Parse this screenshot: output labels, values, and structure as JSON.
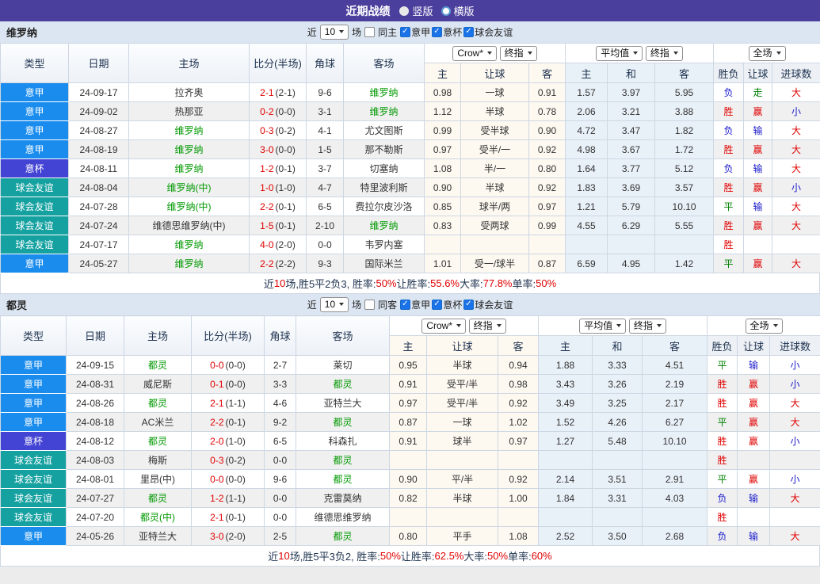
{
  "title_bar": {
    "title": "近期战绩",
    "layout_options": [
      {
        "label": "竖版",
        "selected": true
      },
      {
        "label": "横版",
        "selected": false
      }
    ]
  },
  "colors": {
    "accent_purple": "#4b3f9d",
    "filter_bar_bg": "#dce6f2",
    "league": {
      "意甲": "#1a8cee",
      "意杯": "#4444d4",
      "球会友谊": "#16a1a1"
    },
    "result": {
      "胜": "#e00000",
      "负": "#1a1acc",
      "平": "#008000",
      "赢": "#e00000",
      "输": "#1a1acc",
      "走": "#008000",
      "大": "#e00000",
      "小": "#1a1acc"
    },
    "score_red": "#e00000",
    "team_green": "#009900",
    "summary_red": "#e00000"
  },
  "sections": [
    {
      "team": "维罗纳",
      "filter": {
        "near": "近",
        "count": "10",
        "games": "场",
        "same": "同主",
        "same_checked": false,
        "leagues": [
          {
            "label": "意甲",
            "checked": true
          },
          {
            "label": "意杯",
            "checked": true
          },
          {
            "label": "球会友谊",
            "checked": true
          }
        ]
      },
      "header": {
        "cols": [
          "类型",
          "日期",
          "主场",
          "比分(半场)",
          "角球",
          "客场"
        ],
        "selects": {
          "book": "Crow*",
          "book_end": "终指",
          "avg": "平均值",
          "avg_end": "终指",
          "scope": "全场"
        },
        "handicap": [
          "主",
          "让球",
          "客"
        ],
        "avg": [
          "主",
          "和",
          "客"
        ],
        "result": [
          "胜负",
          "让球",
          "进球数"
        ]
      },
      "rows": [
        {
          "type": "意甲",
          "date": "24-09-17",
          "home": "拉齐奥",
          "home_green": false,
          "score": "2-1",
          "half": "(2-1)",
          "corner": "9-6",
          "away": "维罗纳",
          "away_green": true,
          "odds": [
            "0.98",
            "一球",
            "0.91"
          ],
          "avg": [
            "1.57",
            "3.97",
            "5.95"
          ],
          "res": [
            "负",
            "走",
            "大"
          ]
        },
        {
          "type": "意甲",
          "date": "24-09-02",
          "home": "热那亚",
          "home_green": false,
          "score": "0-2",
          "half": "(0-0)",
          "corner": "3-1",
          "away": "维罗纳",
          "away_green": true,
          "odds": [
            "1.12",
            "半球",
            "0.78"
          ],
          "avg": [
            "2.06",
            "3.21",
            "3.88"
          ],
          "res": [
            "胜",
            "赢",
            "小"
          ]
        },
        {
          "type": "意甲",
          "date": "24-08-27",
          "home": "维罗纳",
          "home_green": true,
          "score": "0-3",
          "half": "(0-2)",
          "corner": "4-1",
          "away": "尤文图斯",
          "away_green": false,
          "odds": [
            "0.99",
            "受半球",
            "0.90"
          ],
          "avg": [
            "4.72",
            "3.47",
            "1.82"
          ],
          "res": [
            "负",
            "输",
            "大"
          ]
        },
        {
          "type": "意甲",
          "date": "24-08-19",
          "home": "维罗纳",
          "home_green": true,
          "score": "3-0",
          "half": "(0-0)",
          "corner": "1-5",
          "away": "那不勒斯",
          "away_green": false,
          "odds": [
            "0.97",
            "受半/一",
            "0.92"
          ],
          "avg": [
            "4.98",
            "3.67",
            "1.72"
          ],
          "res": [
            "胜",
            "赢",
            "大"
          ]
        },
        {
          "type": "意杯",
          "date": "24-08-11",
          "home": "维罗纳",
          "home_green": true,
          "score": "1-2",
          "half": "(0-1)",
          "corner": "3-7",
          "away": "切塞纳",
          "away_green": false,
          "odds": [
            "1.08",
            "半/一",
            "0.80"
          ],
          "avg": [
            "1.64",
            "3.77",
            "5.12"
          ],
          "res": [
            "负",
            "输",
            "大"
          ]
        },
        {
          "type": "球会友谊",
          "date": "24-08-04",
          "home": "维罗纳(中)",
          "home_green": true,
          "score": "1-0",
          "half": "(1-0)",
          "corner": "4-7",
          "away": "特里波利斯",
          "away_green": false,
          "odds": [
            "0.90",
            "半球",
            "0.92"
          ],
          "avg": [
            "1.83",
            "3.69",
            "3.57"
          ],
          "res": [
            "胜",
            "赢",
            "小"
          ]
        },
        {
          "type": "球会友谊",
          "date": "24-07-28",
          "home": "维罗纳(中)",
          "home_green": true,
          "score": "2-2",
          "half": "(0-1)",
          "corner": "6-5",
          "away": "费拉尔皮沙洛",
          "away_green": false,
          "odds": [
            "0.85",
            "球半/两",
            "0.97"
          ],
          "avg": [
            "1.21",
            "5.79",
            "10.10"
          ],
          "res": [
            "平",
            "输",
            "大"
          ]
        },
        {
          "type": "球会友谊",
          "date": "24-07-24",
          "home": "维德思维罗纳(中)",
          "home_green": false,
          "score": "1-5",
          "half": "(0-1)",
          "corner": "2-10",
          "away": "维罗纳",
          "away_green": true,
          "odds": [
            "0.83",
            "受两球",
            "0.99"
          ],
          "avg": [
            "4.55",
            "6.29",
            "5.55"
          ],
          "res": [
            "胜",
            "赢",
            "大"
          ]
        },
        {
          "type": "球会友谊",
          "date": "24-07-17",
          "home": "维罗纳",
          "home_green": true,
          "score": "4-0",
          "half": "(2-0)",
          "corner": "0-0",
          "away": "韦罗内塞",
          "away_green": false,
          "odds": [
            "",
            "",
            ""
          ],
          "avg": [
            "",
            "",
            ""
          ],
          "res": [
            "胜",
            "",
            ""
          ]
        },
        {
          "type": "意甲",
          "date": "24-05-27",
          "home": "维罗纳",
          "home_green": true,
          "score": "2-2",
          "half": "(2-2)",
          "corner": "9-3",
          "away": "国际米兰",
          "away_green": false,
          "odds": [
            "1.01",
            "受一/球半",
            "0.87"
          ],
          "avg": [
            "6.59",
            "4.95",
            "1.42"
          ],
          "res": [
            "平",
            "赢",
            "大"
          ]
        }
      ],
      "summary_parts": [
        {
          "t": "近"
        },
        {
          "t": "10",
          "red": true
        },
        {
          "t": "场,胜5平2负3, 胜率:"
        },
        {
          "t": "50%",
          "red": true
        },
        {
          "t": " 让胜率:"
        },
        {
          "t": "55.6%",
          "red": true
        },
        {
          "t": " 大率:"
        },
        {
          "t": "77.8%",
          "red": true
        },
        {
          "t": " 单率:"
        },
        {
          "t": "50%",
          "red": true
        }
      ]
    },
    {
      "team": "都灵",
      "filter": {
        "near": "近",
        "count": "10",
        "games": "场",
        "same": "同客",
        "same_checked": false,
        "leagues": [
          {
            "label": "意甲",
            "checked": true
          },
          {
            "label": "意杯",
            "checked": true
          },
          {
            "label": "球会友谊",
            "checked": true
          }
        ]
      },
      "header": {
        "cols": [
          "类型",
          "日期",
          "主场",
          "比分(半场)",
          "角球",
          "客场"
        ],
        "selects": {
          "book": "Crow*",
          "book_end": "终指",
          "avg": "平均值",
          "avg_end": "终指",
          "scope": "全场"
        },
        "handicap": [
          "主",
          "让球",
          "客"
        ],
        "avg": [
          "主",
          "和",
          "客"
        ],
        "result": [
          "胜负",
          "让球",
          "进球数"
        ]
      },
      "rows": [
        {
          "type": "意甲",
          "date": "24-09-15",
          "home": "都灵",
          "home_green": true,
          "score": "0-0",
          "half": "(0-0)",
          "corner": "2-7",
          "away": "莱切",
          "away_green": false,
          "odds": [
            "0.95",
            "半球",
            "0.94"
          ],
          "avg": [
            "1.88",
            "3.33",
            "4.51"
          ],
          "res": [
            "平",
            "输",
            "小"
          ]
        },
        {
          "type": "意甲",
          "date": "24-08-31",
          "home": "威尼斯",
          "home_green": false,
          "score": "0-1",
          "half": "(0-0)",
          "corner": "3-3",
          "away": "都灵",
          "away_green": true,
          "odds": [
            "0.91",
            "受平/半",
            "0.98"
          ],
          "avg": [
            "3.43",
            "3.26",
            "2.19"
          ],
          "res": [
            "胜",
            "赢",
            "小"
          ]
        },
        {
          "type": "意甲",
          "date": "24-08-26",
          "home": "都灵",
          "home_green": true,
          "score": "2-1",
          "half": "(1-1)",
          "corner": "4-6",
          "away": "亚特兰大",
          "away_green": false,
          "odds": [
            "0.97",
            "受平/半",
            "0.92"
          ],
          "avg": [
            "3.49",
            "3.25",
            "2.17"
          ],
          "res": [
            "胜",
            "赢",
            "大"
          ]
        },
        {
          "type": "意甲",
          "date": "24-08-18",
          "home": "AC米兰",
          "home_green": false,
          "score": "2-2",
          "half": "(0-1)",
          "corner": "9-2",
          "away": "都灵",
          "away_green": true,
          "odds": [
            "0.87",
            "一球",
            "1.02"
          ],
          "avg": [
            "1.52",
            "4.26",
            "6.27"
          ],
          "res": [
            "平",
            "赢",
            "大"
          ]
        },
        {
          "type": "意杯",
          "date": "24-08-12",
          "home": "都灵",
          "home_green": true,
          "score": "2-0",
          "half": "(1-0)",
          "corner": "6-5",
          "away": "科森扎",
          "away_green": false,
          "odds": [
            "0.91",
            "球半",
            "0.97"
          ],
          "avg": [
            "1.27",
            "5.48",
            "10.10"
          ],
          "res": [
            "胜",
            "赢",
            "小"
          ]
        },
        {
          "type": "球会友谊",
          "date": "24-08-03",
          "home": "梅斯",
          "home_green": false,
          "score": "0-3",
          "half": "(0-2)",
          "corner": "0-0",
          "away": "都灵",
          "away_green": true,
          "odds": [
            "",
            "",
            ""
          ],
          "avg": [
            "",
            "",
            ""
          ],
          "res": [
            "胜",
            "",
            ""
          ]
        },
        {
          "type": "球会友谊",
          "date": "24-08-01",
          "home": "里昂(中)",
          "home_green": false,
          "score": "0-0",
          "half": "(0-0)",
          "corner": "9-6",
          "away": "都灵",
          "away_green": true,
          "odds": [
            "0.90",
            "平/半",
            "0.92"
          ],
          "avg": [
            "2.14",
            "3.51",
            "2.91"
          ],
          "res": [
            "平",
            "赢",
            "小"
          ]
        },
        {
          "type": "球会友谊",
          "date": "24-07-27",
          "home": "都灵",
          "home_green": true,
          "score": "1-2",
          "half": "(1-1)",
          "corner": "0-0",
          "away": "克雷莫纳",
          "away_green": false,
          "odds": [
            "0.82",
            "半球",
            "1.00"
          ],
          "avg": [
            "1.84",
            "3.31",
            "4.03"
          ],
          "res": [
            "负",
            "输",
            "大"
          ]
        },
        {
          "type": "球会友谊",
          "date": "24-07-20",
          "home": "都灵(中)",
          "home_green": true,
          "score": "2-1",
          "half": "(0-1)",
          "corner": "0-0",
          "away": "维德思维罗纳",
          "away_green": false,
          "odds": [
            "",
            "",
            ""
          ],
          "avg": [
            "",
            "",
            ""
          ],
          "res": [
            "胜",
            "",
            ""
          ]
        },
        {
          "type": "意甲",
          "date": "24-05-26",
          "home": "亚特兰大",
          "home_green": false,
          "score": "3-0",
          "half": "(2-0)",
          "corner": "2-5",
          "away": "都灵",
          "away_green": true,
          "odds": [
            "0.80",
            "平手",
            "1.08"
          ],
          "avg": [
            "2.52",
            "3.50",
            "2.68"
          ],
          "res": [
            "负",
            "输",
            "大"
          ]
        }
      ],
      "summary_parts": [
        {
          "t": "近"
        },
        {
          "t": "10",
          "red": true
        },
        {
          "t": "场,胜5平3负2, 胜率:"
        },
        {
          "t": "50%",
          "red": true
        },
        {
          "t": " 让胜率:"
        },
        {
          "t": "62.5%",
          "red": true
        },
        {
          "t": " 大率:"
        },
        {
          "t": "50%",
          "red": true
        },
        {
          "t": " 单率:"
        },
        {
          "t": "60%",
          "red": true
        }
      ]
    }
  ]
}
